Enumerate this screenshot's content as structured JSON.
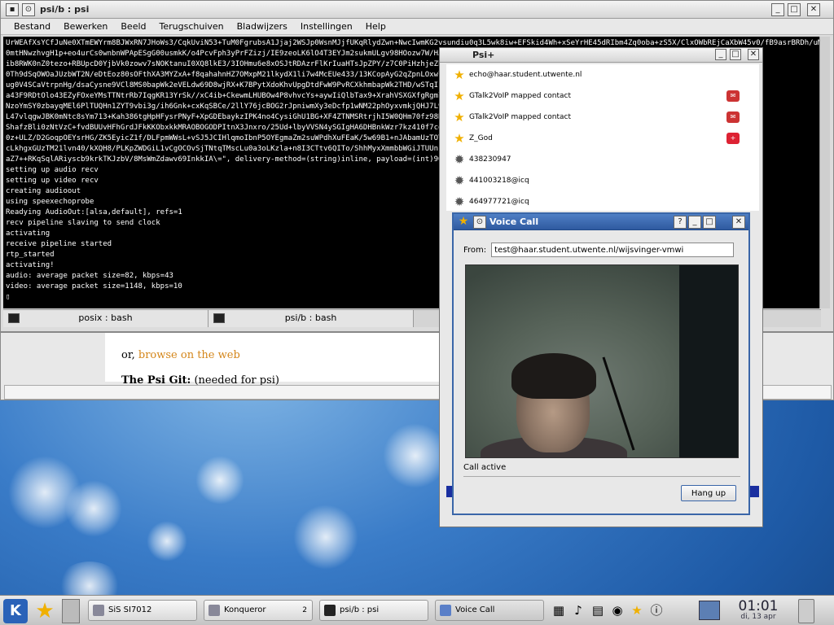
{
  "terminal": {
    "title": "psi/b : psi",
    "menu": [
      "Bestand",
      "Bewerken",
      "Beeld",
      "Terugschuiven",
      "Bladwijzers",
      "Instellingen",
      "Help"
    ],
    "lines": [
      "UrWEAfXsYCfJuNe0XTmEWYrm8BJWxRN7JHoWs3/CqkUviN53+TuM0FgrubsA1Jjaj2WSJp0WsnMJjfUKqRlydZwn+NwcIwmKG2vsundiu0q3L5wk8iw+EFSkid4Wh+xSeYrHE45dRIbm4Zq0oba+zS5X/ClxOWbREjCaXbW45v0/fB9asrBRDh/uMuoKhVSHb0E0u",
      "0mtHNwzhvgH1p+eo4urCs0wnbnWPApESgG00usmkK/o4PcvFph3yPrFZizj/IE9zeoLK6lO4T3EYJm2sukmULgv98HOozw7W/HJjF/AKqT",
      "ib8RWK0nZ0tezo+RBUpcD0YjbVk0zowv7sNOKtanuI0XQ8lkE3/3IOHmu6e8xOSJtRDAzrFlKrIuaHTsJpZPY/z7C0PiHzhjeZbn52j15nR",
      "0Th9dSqOWOaJUzbWT2N/eDtEoz80sOFthXA3MYZxA+f8qahahnHZ7OMxpM21lkydX1li7w4McEUe433/13KCopAyG2qZpnLOxw7dRVliH48",
      "ug0V4SCaVtrpnHg/dsaCysne9VCl8MS0bapWk2eVELdw69D8wjRX+K7BPytXdoKhvUpgDtdFwW9PvRCXkhmbapWk2THD/wSTqI1lY3qUoeA",
      "a43F9RDtOlo43EZyFOxeYMsTTNtrRb7IqgKR13YrSk//xC4ib+CkewmLHUBOw4P8vhvcYs+aywIiQlbTax9+XrahVSXGXfgRgmlba6SZoqL",
      "NzoYmSY0zbayqMEl6PlTUQHn1ZYT9vbi3g/ih6Gnk+cxKqSBCe/2llY76jcBOG2rJpniwmXy3eDcfp1wNM22phOyxvmkjQHJ7L9CVLiJSbW",
      "L47vlqgwJBK0mNtc8sYm713+Kah386tgHpHFysrPNyF+XpGDEbaykzIPK4no4CysiGhU1BG+XF4ZTNMSRtrjhI5W0QHm70fz98BG5SPp/V",
      "ShafzBli0zNtVzC+fvdBUUvHFhGrdJFkKKObxkkMRAOBOGODPItnX3Jnxro/25Ud+lbyVVSN4ySGIgHA6DHBnkWzr7kz410f7cqO/SytSH",
      "0z+ULZ/D2GoqpOEYsrHG/ZK5EyicZ1f/DLFpmWWsL+vSJ5JCIHlqmoIbnP5OYEgmaZm2suWPdhXuFEaK/5w69B1+nJAbamUzTOYjhfdUpgH",
      "cLkhgxGUzTM21lvn40/kXQH8/PLKpZWDGiL1vCgOCOvSjTNtqTMscLu0a3oLKzla+n8I3CTtv6QITo/ShhMyxXmmbbWGiJTUUnkOPp603HP",
      "aZ7++RKqSqlARiyscb9krkTKJzbV/8MsWmZdawv69InkkIA\\=\", delivery-method=(string)inline, payload=(int)96, ssrc=(",
      "setting up audio recv",
      "setting up video recv",
      "creating audioout",
      "using speexechoprobe",
      "Readying AudioOut:[alsa,default], refs=1",
      "recv pipeline slaving to send clock",
      "activating",
      "receive pipeline started",
      "rtp_started",
      "activating!",
      "audio: average packet size=82, kbps=43",
      "video: average packet size=1148, kbps=10",
      "▯"
    ],
    "tabs": [
      "posix : bash",
      "psi/b : bash"
    ]
  },
  "konqueror": {
    "text_before": "or, ",
    "link": "browse on the web",
    "heading": "The Psi Git:",
    "heading_note": " (needed for psi)"
  },
  "psi": {
    "title": "Psi+",
    "contacts": [
      {
        "name": "echo@haar.student.utwente.nl",
        "icon": "star",
        "badge": ""
      },
      {
        "name": "GTalk2VoIP mapped contact",
        "icon": "star",
        "badge": "gmail"
      },
      {
        "name": "GTalk2VoIP mapped contact",
        "icon": "star",
        "badge": "gmail"
      },
      {
        "name": "Z_God",
        "icon": "star",
        "badge": "plus"
      },
      {
        "name": "438230947",
        "icon": "gear",
        "badge": ""
      },
      {
        "name": "441003218@icq",
        "icon": "gear",
        "badge": ""
      },
      {
        "name": "464977721@icq",
        "icon": "gear",
        "badge": ""
      }
    ]
  },
  "voice_call": {
    "title": "Voice Call",
    "from_label": "From:",
    "from_value": "test@haar.student.utwente.nl/wijsvinger-vmwi",
    "status": "Call active",
    "hangup_label": "Hang up"
  },
  "taskbar": {
    "tasks": [
      {
        "label": "SiS SI7012",
        "icon": "wifi-icon"
      },
      {
        "label": "Konqueror",
        "icon": "konqueror-icon"
      },
      {
        "label": "psi/b : psi",
        "icon": "terminal-icon"
      },
      {
        "label": "Voice Call",
        "icon": "psi-icon"
      }
    ],
    "konqueror_count": "2",
    "time": "01:01",
    "date": "di, 13 apr"
  },
  "colors": {
    "accent": "#3a66a8",
    "link_orange": "#d4861a",
    "terminal_bg": "#000000"
  }
}
